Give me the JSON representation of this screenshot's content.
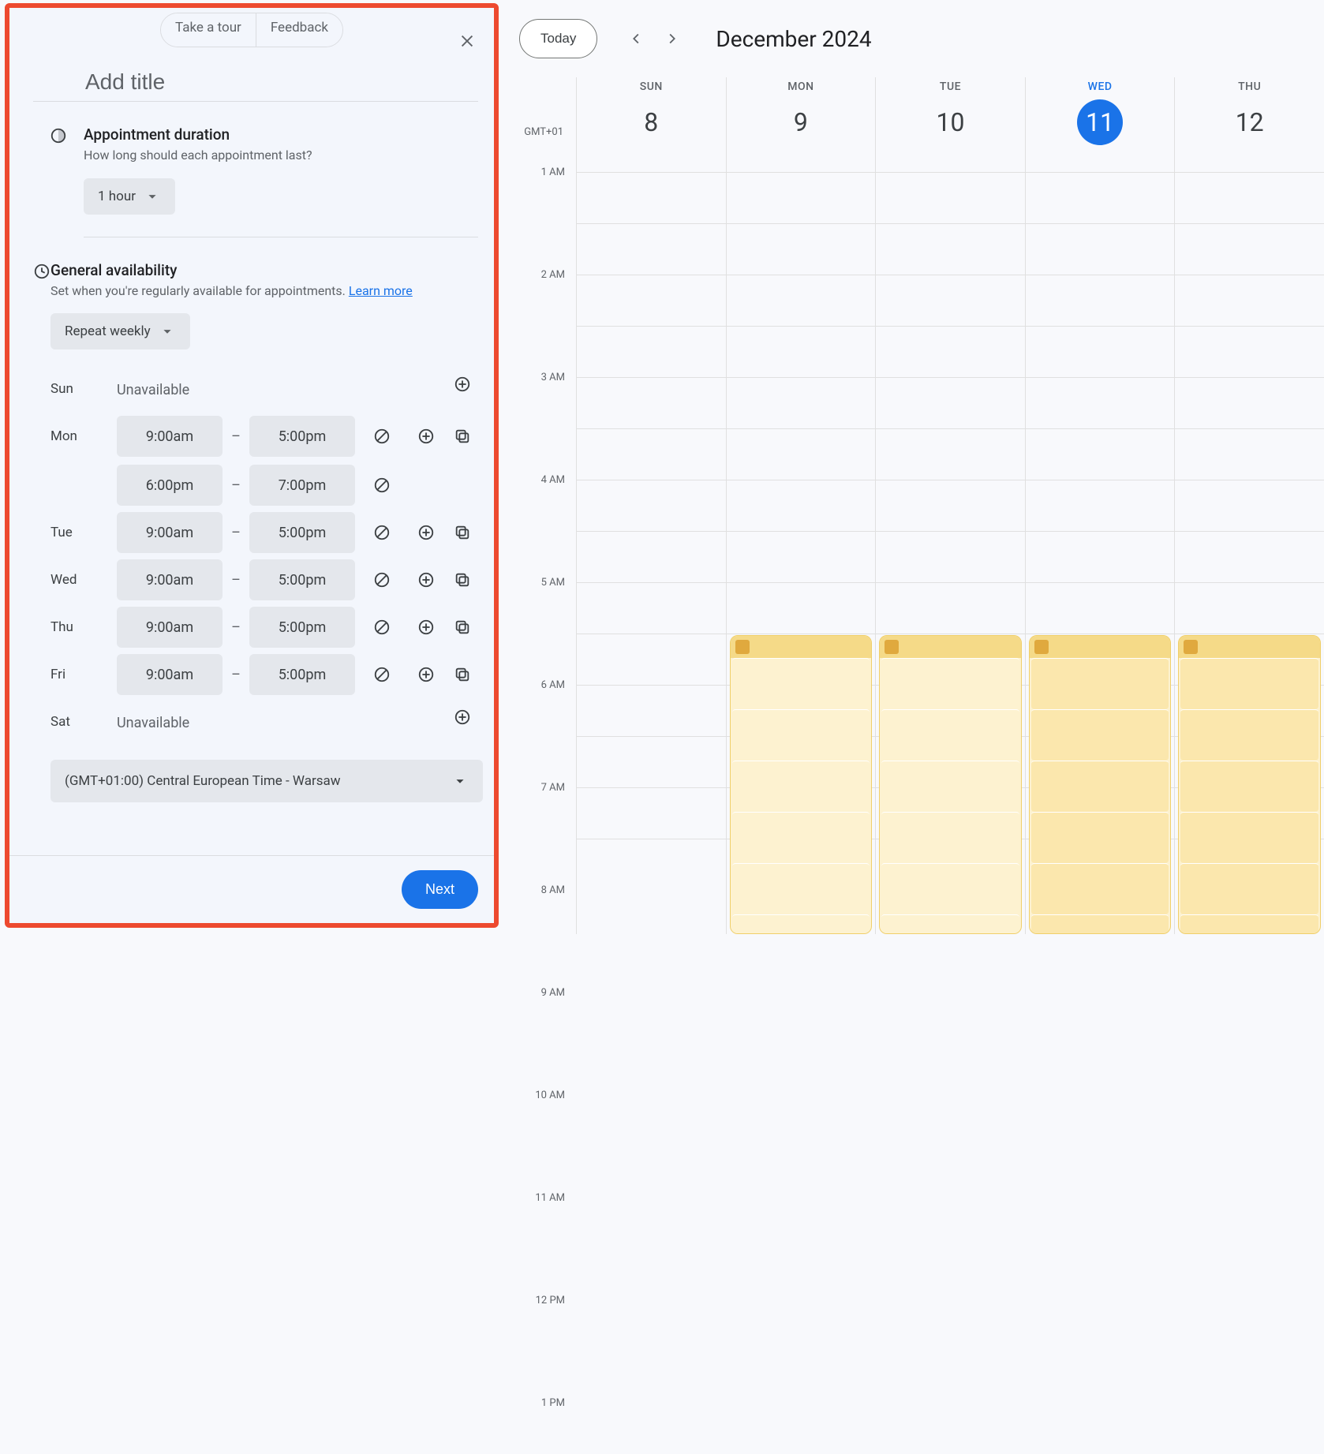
{
  "panel": {
    "take_tour": "Take a tour",
    "feedback": "Feedback",
    "title_placeholder": "Add title",
    "duration": {
      "heading": "Appointment duration",
      "sub": "How long should each appointment last?",
      "value": "1 hour"
    },
    "availability": {
      "heading": "General availability",
      "sub_prefix": "Set when you're regularly available for appointments. ",
      "learn_more": "Learn more",
      "repeat": "Repeat weekly",
      "days": [
        {
          "label": "Sun",
          "unavailable": "Unavailable",
          "slots": []
        },
        {
          "label": "Mon",
          "slots": [
            {
              "start": "9:00am",
              "end": "5:00pm"
            },
            {
              "start": "6:00pm",
              "end": "7:00pm"
            }
          ]
        },
        {
          "label": "Tue",
          "slots": [
            {
              "start": "9:00am",
              "end": "5:00pm"
            }
          ]
        },
        {
          "label": "Wed",
          "slots": [
            {
              "start": "9:00am",
              "end": "5:00pm"
            }
          ]
        },
        {
          "label": "Thu",
          "slots": [
            {
              "start": "9:00am",
              "end": "5:00pm"
            }
          ]
        },
        {
          "label": "Fri",
          "slots": [
            {
              "start": "9:00am",
              "end": "5:00pm"
            }
          ]
        },
        {
          "label": "Sat",
          "unavailable": "Unavailable",
          "slots": []
        }
      ],
      "timezone": "(GMT+01:00) Central European Time - Warsaw"
    },
    "next": "Next"
  },
  "calendar": {
    "today": "Today",
    "month": "December 2024",
    "tz": "GMT+01",
    "days": [
      {
        "dow": "SUN",
        "num": "8",
        "today": false,
        "has_block": false
      },
      {
        "dow": "MON",
        "num": "9",
        "today": false,
        "has_block": true,
        "light": true
      },
      {
        "dow": "TUE",
        "num": "10",
        "today": false,
        "has_block": true,
        "light": true
      },
      {
        "dow": "WED",
        "num": "11",
        "today": true,
        "has_block": true,
        "light": false
      },
      {
        "dow": "THU",
        "num": "12",
        "today": false,
        "has_block": true,
        "light": false
      }
    ],
    "hours": [
      "1 AM",
      "2 AM",
      "3 AM",
      "4 AM",
      "5 AM",
      "6 AM",
      "7 AM",
      "8 AM",
      "9 AM",
      "10 AM",
      "11 AM",
      "12 PM",
      "1 PM"
    ]
  }
}
